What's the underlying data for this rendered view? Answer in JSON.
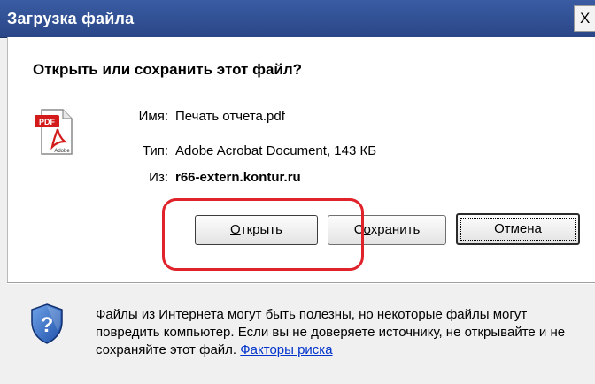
{
  "window": {
    "title": "Загрузка файла",
    "close_label": "X"
  },
  "dialog": {
    "heading": "Открыть или сохранить этот файл?",
    "file_icon": "pdf-file-icon",
    "fields": {
      "name_label": "Имя:",
      "name_value": "Печать отчета.pdf",
      "type_label": "Тип:",
      "type_value": "Adobe Acrobat Document, 143 КБ",
      "from_label": "Из:",
      "from_value": "r66-extern.kontur.ru"
    },
    "buttons": {
      "open_accel": "О",
      "open_rest": "ткрыть",
      "save_pre": "С",
      "save_accel": "о",
      "save_rest": "хранить",
      "cancel": "Отмена"
    },
    "warning": {
      "icon": "shield-question-icon",
      "text": "Файлы из Интернета могут быть полезны, но некоторые файлы могут повредить компьютер. Если вы не доверяете источнику, не открывайте и не сохраняйте этот файл.",
      "link": "Факторы риска"
    }
  },
  "annotation": {
    "color": "#e0222b",
    "shape": "rounded-rectangle highlight around Open button"
  }
}
